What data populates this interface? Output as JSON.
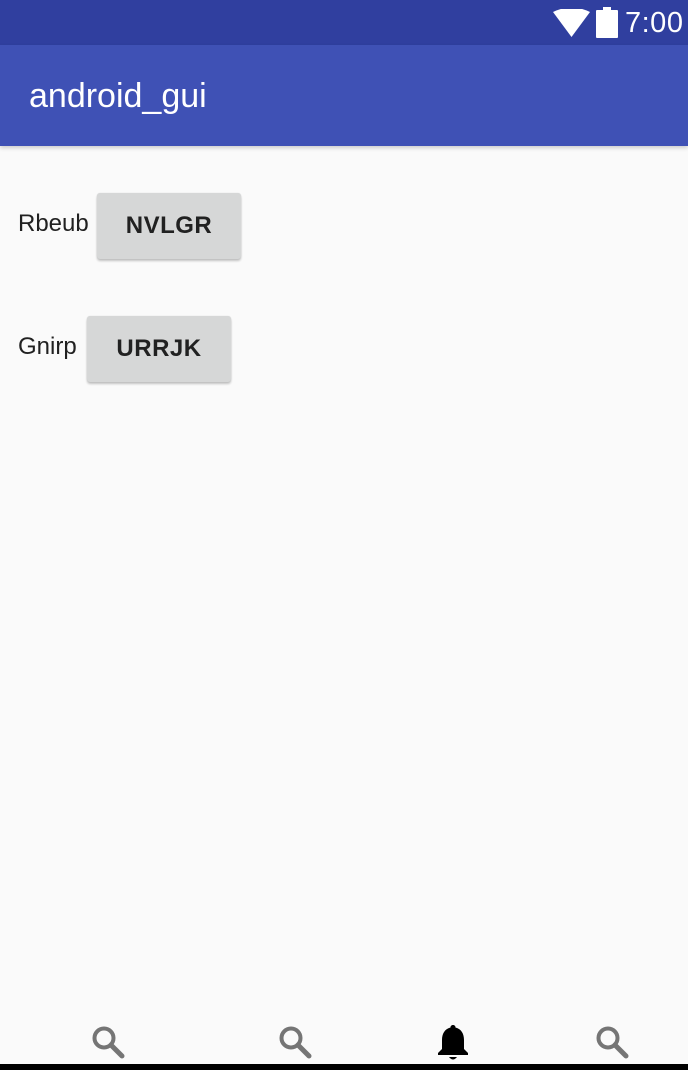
{
  "status_bar": {
    "time": "7:00",
    "icons": [
      "wifi-icon",
      "battery-icon"
    ],
    "color": "#303f9f"
  },
  "app_bar": {
    "title": "android_gui",
    "color": "#3f51b5"
  },
  "rows": [
    {
      "label": "Rbeub",
      "button": "NVLGR"
    },
    {
      "label": "Gnirp",
      "button": "URRJK"
    }
  ],
  "bottom_nav": {
    "items": [
      {
        "icon": "search-icon"
      },
      {
        "icon": "search-icon"
      },
      {
        "icon": "bell-icon",
        "active": true
      },
      {
        "icon": "search-icon"
      }
    ]
  }
}
